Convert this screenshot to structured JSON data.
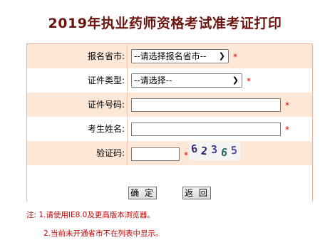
{
  "title": "2019年执业药师资格考试准考证打印",
  "form": {
    "province_label": "报名省市:",
    "province_value": "--请选择报名省市--",
    "id_type_label": "证件类型:",
    "id_type_value": "--请选择--",
    "id_number_label": "证件号码:",
    "id_number_value": "",
    "name_label": "考生姓名:",
    "name_value": "",
    "captcha_label": "验证码:",
    "captcha_value": "",
    "captcha_image_text": "62365",
    "required_mark": "*"
  },
  "buttons": {
    "confirm": "确 定",
    "back": "返 回"
  },
  "notes": {
    "line1": "注: 1.请使用IE8.0及更高版本浏览器。",
    "line2": "2.当前未开通省市不在列表中显示。"
  },
  "icons": {
    "dropdown": "chevron-down-icon"
  }
}
